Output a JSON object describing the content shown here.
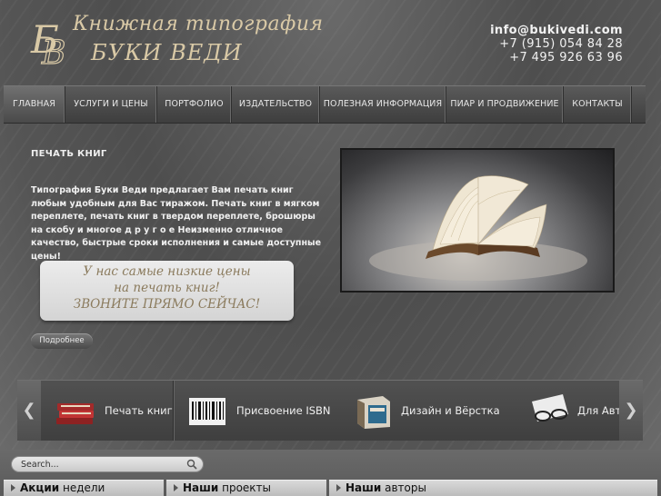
{
  "brand": {
    "monogram": "БВ",
    "line1": "Книжная типография",
    "line2": "БУКИ ВЕДИ"
  },
  "contacts": {
    "email": "info@bukivedi.com",
    "phone1": "+7 (915) 054 84 28",
    "phone2": "+7 495 926 63 96"
  },
  "nav": {
    "items": [
      {
        "label": "ГЛАВНАЯ",
        "active": true
      },
      {
        "label": "УСЛУГИ И ЦЕНЫ"
      },
      {
        "label": "ПОРТФОЛИО"
      },
      {
        "label": "ИЗДАТЕЛЬСТВО"
      },
      {
        "label": "ПОЛЕЗНАЯ ИНФОРМАЦИЯ"
      },
      {
        "label": "ПИАР И ПРОДВИЖЕНИЕ"
      },
      {
        "label": "КОНТАКТЫ"
      }
    ]
  },
  "promo": {
    "title": "ПЕЧАТЬ КНИГ",
    "text": "Типография Буки Веди предлагает Вам печать книг любым удобным для Вас тиражом. Печать книг в мягком переплете, печать книг в твердом переплете, брошюры на скобу и многое д р у г о е   Неизменно отличное качество, быстрые сроки исполнения и самые доступные цены!",
    "callout_line1": "У нас самые низкие цены",
    "callout_line2": "на печать книг!",
    "callout_line3": "ЗВОНИТЕ ПРЯМО СЕЙЧАС!",
    "more_label": "Подробнее"
  },
  "carousel": {
    "prev_icon": "chevron-left-icon",
    "next_icon": "chevron-right-icon",
    "items": [
      {
        "label": "Печать книг",
        "icon": "books-icon"
      },
      {
        "label": "Присвоение ISBN",
        "icon": "barcode-icon"
      },
      {
        "label": "Дизайн и Вёрстка",
        "icon": "design-box-icon"
      },
      {
        "label": "Для Авт",
        "icon": "glasses-icon"
      }
    ]
  },
  "search": {
    "placeholder": "Search..."
  },
  "columns": [
    {
      "bold": "Акции",
      "rest": " недели"
    },
    {
      "bold": "Наши",
      "rest": " проекты"
    },
    {
      "bold": "Наши",
      "rest": " авторы"
    }
  ]
}
